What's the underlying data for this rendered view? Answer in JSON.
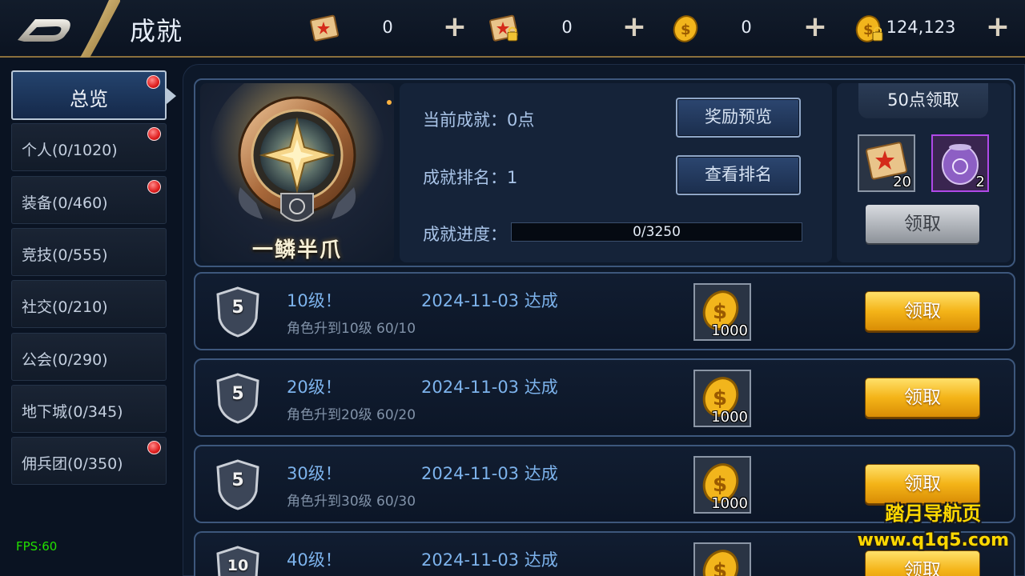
{
  "header": {
    "title": "成就",
    "currencies": [
      {
        "icon": "scroll-icon",
        "value": "0"
      },
      {
        "icon": "locked-scroll-icon",
        "value": "0"
      },
      {
        "icon": "gold-coin-icon",
        "value": "0"
      },
      {
        "icon": "locked-gold-coin-icon",
        "value": "124,123"
      }
    ],
    "plus_label": "+"
  },
  "sidebar": {
    "items": [
      {
        "label": "总览",
        "active": true,
        "reddot": true
      },
      {
        "label": "个人(0/1020)",
        "active": false,
        "reddot": true
      },
      {
        "label": "装备(0/460)",
        "active": false,
        "reddot": true
      },
      {
        "label": "竞技(0/555)",
        "active": false,
        "reddot": false
      },
      {
        "label": "社交(0/210)",
        "active": false,
        "reddot": false
      },
      {
        "label": "公会(0/290)",
        "active": false,
        "reddot": false
      },
      {
        "label": "地下城(0/345)",
        "active": false,
        "reddot": false
      },
      {
        "label": "佣兵团(0/350)",
        "active": false,
        "reddot": true
      }
    ]
  },
  "fps": "FPS:60",
  "summary": {
    "medal_name": "一鳞半爪",
    "current_label": "当前成就：0点",
    "rank_label": "成就排名：1",
    "progress_label": "成就进度：",
    "progress_text": "0/3250",
    "progress_fraction": 0,
    "preview_button": "奖励预览",
    "rank_button": "查看排名",
    "reward_title": "50点领取",
    "reward_items": [
      {
        "icon": "red-scroll-icon",
        "count": "20",
        "rarity": "normal"
      },
      {
        "icon": "purple-orb-icon",
        "count": "2",
        "rarity": "epic"
      }
    ],
    "claim_button": "领取"
  },
  "achievements": [
    {
      "badge": "5",
      "name": "10级！",
      "date": "2024-11-03 达成",
      "desc": "角色升到10级 60/10",
      "reward_count": "1000",
      "button": "领取"
    },
    {
      "badge": "5",
      "name": "20级！",
      "date": "2024-11-03 达成",
      "desc": "角色升到20级 60/20",
      "reward_count": "1000",
      "button": "领取"
    },
    {
      "badge": "5",
      "name": "30级！",
      "date": "2024-11-03 达成",
      "desc": "角色升到30级 60/30",
      "reward_count": "1000",
      "button": "领取"
    },
    {
      "badge": "10",
      "name": "40级！",
      "date": "2024-11-03 达成",
      "desc": "",
      "reward_count": "",
      "button": "领取"
    }
  ],
  "watermark": {
    "line1": "踏月导航页",
    "line2": "www.q1q5.com"
  },
  "colors": {
    "accent_gold": "#f4b418",
    "text_blue": "#7db3ec",
    "reddot": "#e01e1e",
    "border_blue": "#3d577c"
  }
}
